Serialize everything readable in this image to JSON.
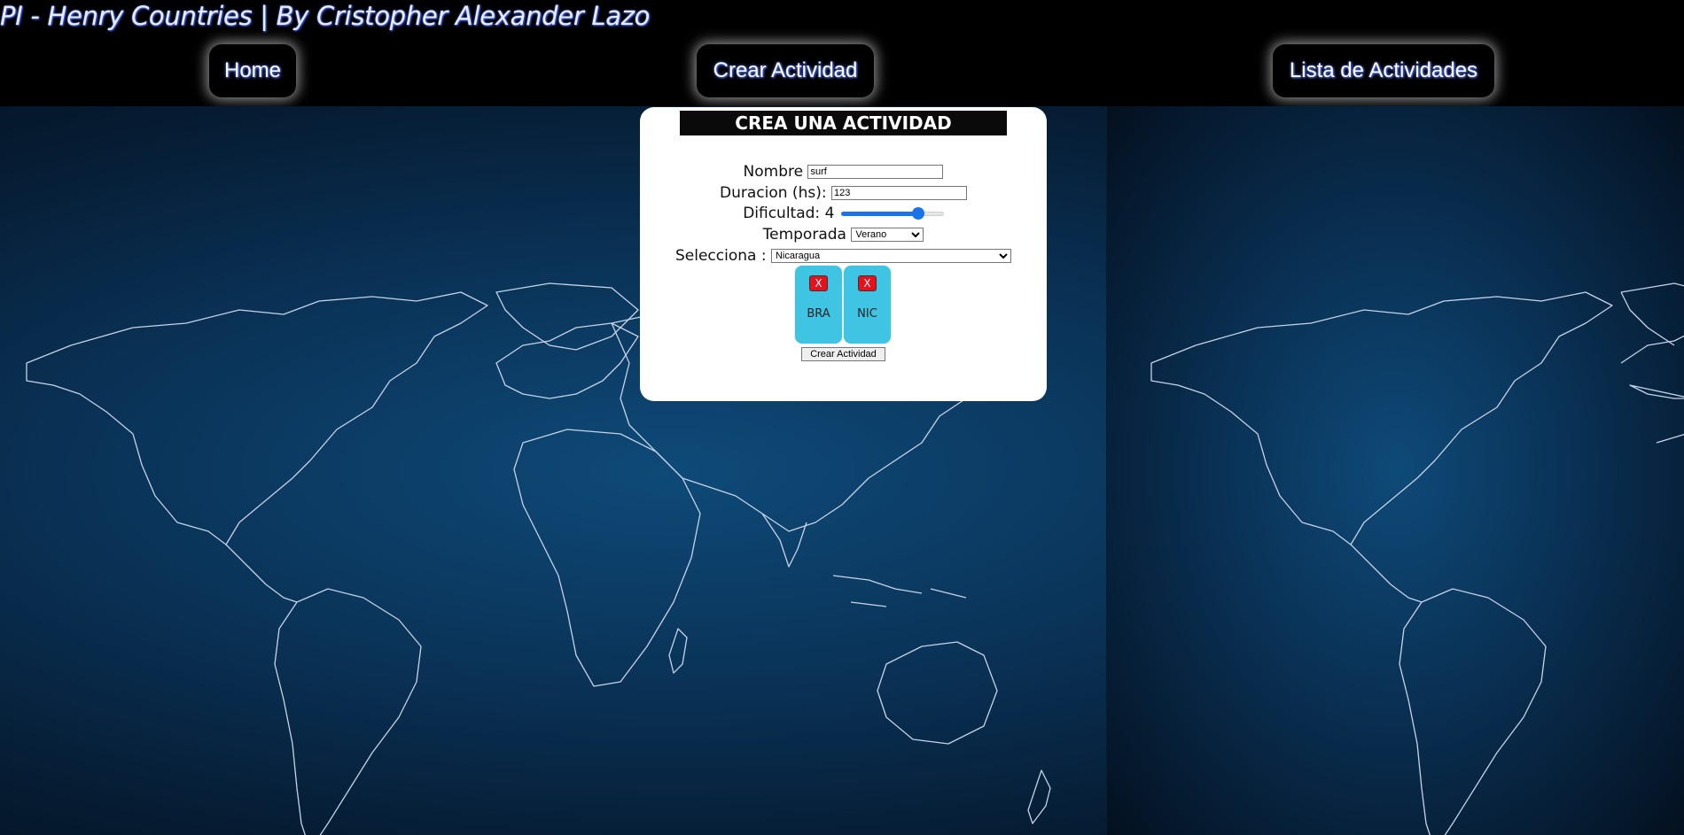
{
  "header": {
    "site_title": "PI - Henry Countries | By Cristopher Alexander Lazo",
    "nav": {
      "home": "Home",
      "create": "Crear Actividad",
      "list": "Lista de Actividades"
    }
  },
  "form": {
    "title": "CREA UNA ACTIVIDAD",
    "name_label": "Nombre",
    "name_value": "surf",
    "duration_label": "Duracion (hs):",
    "duration_value": "123",
    "difficulty_label": "Dificultad:",
    "difficulty_value": "4",
    "difficulty_min": 1,
    "difficulty_max": 5,
    "season_label": "Temporada",
    "season_value": "Verano",
    "country_label": "Selecciona :",
    "country_value": "Nicaragua",
    "selected_countries": [
      {
        "code": "BRA",
        "remove_label": "X"
      },
      {
        "code": "NIC",
        "remove_label": "X"
      }
    ],
    "submit_label": "Crear Actividad"
  },
  "colors": {
    "chip_bg": "#3fc4e4",
    "remove_btn": "#e8101a",
    "slider": "#1a73e8",
    "map_bg": "#0a3358"
  }
}
